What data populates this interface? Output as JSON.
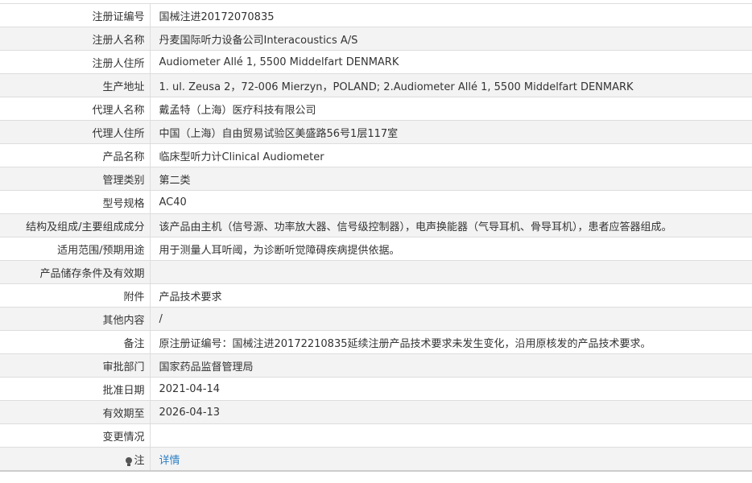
{
  "rows": [
    {
      "label": "注册证编号",
      "value": "国械注进20172070835"
    },
    {
      "label": "注册人名称",
      "value": "丹麦国际听力设备公司Interacoustics A/S"
    },
    {
      "label": "注册人住所",
      "value": "Audiometer Allé 1, 5500 Middelfart DENMARK"
    },
    {
      "label": "生产地址",
      "value": "1. ul. Zeusa 2，72-006 Mierzyn，POLAND; 2.Audiometer Allé 1, 5500 Middelfart DENMARK"
    },
    {
      "label": "代理人名称",
      "value": "戴孟特（上海）医疗科技有限公司"
    },
    {
      "label": "代理人住所",
      "value": "中国（上海）自由贸易试验区美盛路56号1层117室"
    },
    {
      "label": "产品名称",
      "value": "临床型听力计Clinical Audiometer"
    },
    {
      "label": "管理类别",
      "value": "第二类"
    },
    {
      "label": "型号规格",
      "value": "AC40"
    },
    {
      "label": "结构及组成/主要组成成分",
      "value": "该产品由主机（信号源、功率放大器、信号级控制器），电声换能器（气导耳机、骨导耳机），患者应答器组成。"
    },
    {
      "label": "适用范围/预期用途",
      "value": "用于测量人耳听阈，为诊断听觉障碍疾病提供依据。"
    },
    {
      "label": "产品储存条件及有效期",
      "value": ""
    },
    {
      "label": "附件",
      "value": "产品技术要求"
    },
    {
      "label": "其他内容",
      "value": "/"
    },
    {
      "label": "备注",
      "value": "原注册证编号：国械注进20172210835延续注册产品技术要求未发生变化，沿用原核发的产品技术要求。"
    },
    {
      "label": "审批部门",
      "value": "国家药品监督管理局"
    },
    {
      "label": "批准日期",
      "value": "2021-04-14"
    },
    {
      "label": "有效期至",
      "value": "2026-04-13"
    },
    {
      "label": "变更情况",
      "value": ""
    }
  ],
  "note_row": {
    "icon": "lightbulb-icon",
    "label": "注",
    "link_text": "详情"
  },
  "colors": {
    "link": "#2b7fc3",
    "stripe": "#f3f3f3",
    "border": "#dddddd"
  }
}
